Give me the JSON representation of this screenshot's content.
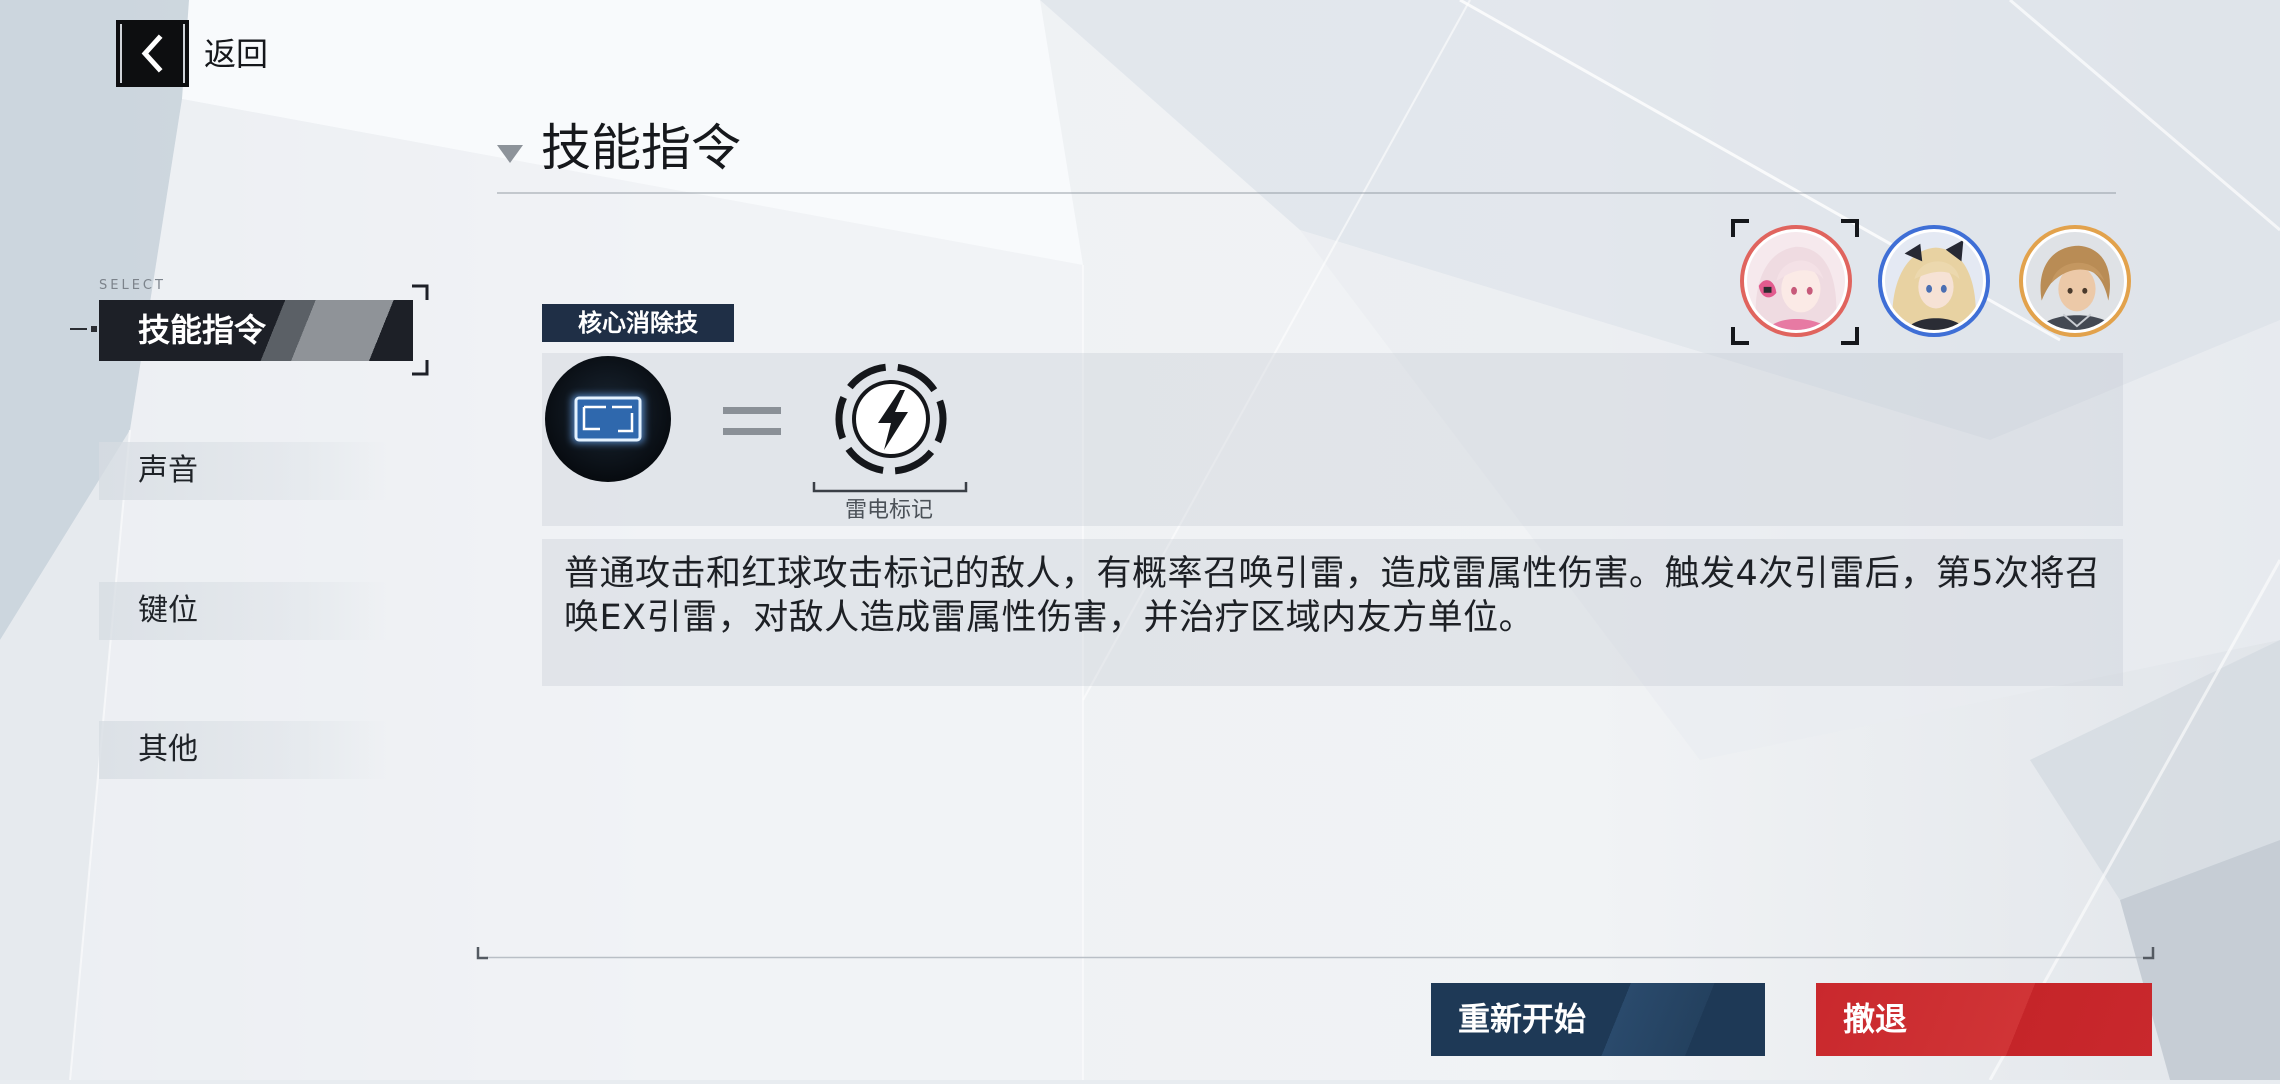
{
  "header": {
    "back_label": "返回"
  },
  "page_title": "技能指令",
  "sidebar": {
    "select_caption": "SELECT",
    "items": [
      {
        "label": "技能指令",
        "selected": true
      },
      {
        "label": "声音",
        "selected": false
      },
      {
        "label": "键位",
        "selected": false
      },
      {
        "label": "其他",
        "selected": false
      }
    ]
  },
  "party": [
    {
      "ring_color": "#e0645e",
      "selected": true
    },
    {
      "ring_color": "#3f6fd6",
      "selected": false
    },
    {
      "ring_color": "#e2a24c",
      "selected": false
    }
  ],
  "skill": {
    "tag": "核心消除技",
    "mark_caption": "雷电标记",
    "description_lines": [
      "普通攻击和红球攻击标记的敌人，有概率召唤引雷，造成雷属性伤害。触发4次引雷后，第5次将召",
      "唤EX引雷，对敌人造成雷属性伤害，并治疗区域内友方单位。"
    ]
  },
  "actions": {
    "restart_label": "重新开始",
    "retreat_label": "撤退"
  },
  "icons": {
    "back": "chevron-left-icon",
    "title_marker": "triangle-down-icon",
    "core_elimination": "core-elimination-icon",
    "equals": "equals-icon",
    "lightning_mark": "lightning-mark-icon"
  },
  "colors": {
    "selected_tab_bg": "#1d2027",
    "tag_bg": "#1f2f46",
    "restart_button": "#1e3956",
    "retreat_button": "#c9282d",
    "text_primary": "#1c1f24"
  }
}
